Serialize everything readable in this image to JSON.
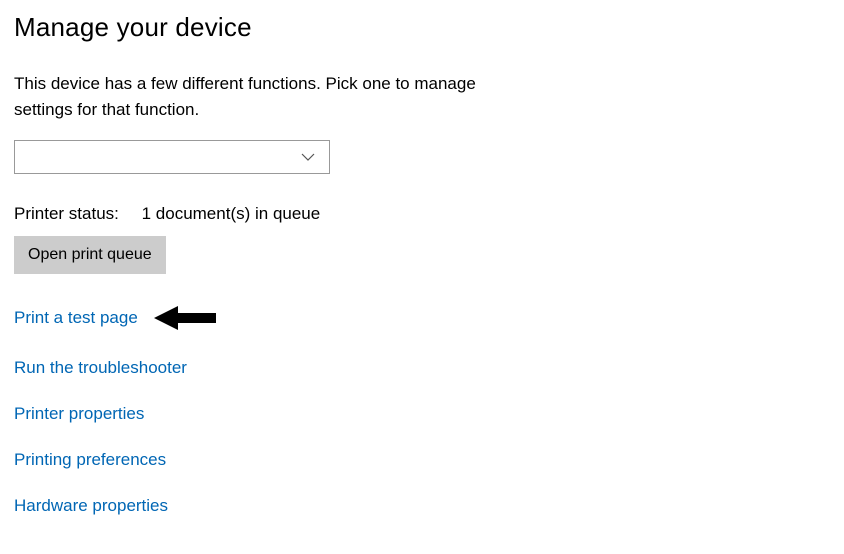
{
  "header": {
    "title": "Manage your device"
  },
  "description": "This device has a few different functions. Pick one to manage settings for that function.",
  "dropdown": {
    "selected": ""
  },
  "status": {
    "label": "Printer status:",
    "value": "1 document(s) in queue"
  },
  "buttons": {
    "open_queue": "Open print queue"
  },
  "links": {
    "print_test_page": "Print a test page",
    "run_troubleshooter": "Run the troubleshooter",
    "printer_properties": "Printer properties",
    "printing_preferences": "Printing preferences",
    "hardware_properties": "Hardware properties"
  }
}
